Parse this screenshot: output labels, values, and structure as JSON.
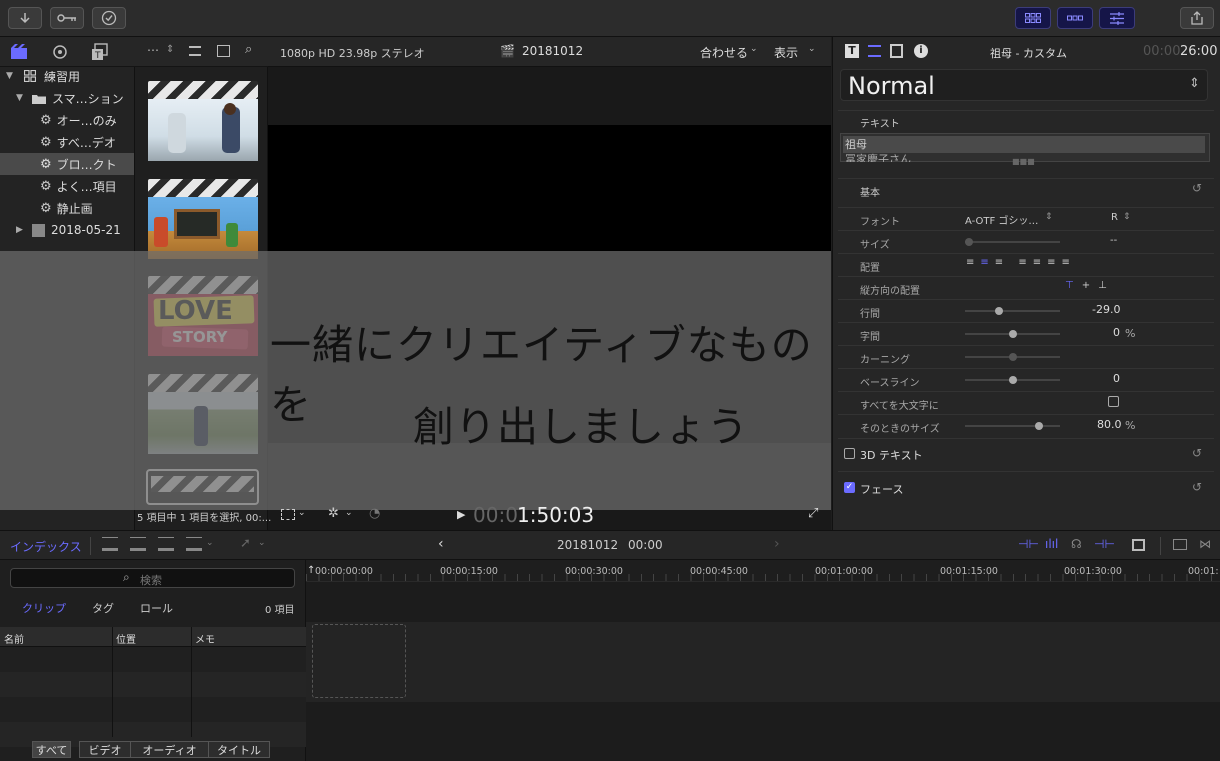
{
  "toolbar": {
    "import_icon": "down-arrow-icon",
    "keywords_icon": "key-icon",
    "check_icon": "checkmark-icon",
    "share_icon": "share-icon"
  },
  "library": {
    "items": [
      {
        "label": "練習用"
      },
      {
        "label": "スマ…ション"
      },
      {
        "label": "オー…のみ"
      },
      {
        "label": "すべ…デオ"
      },
      {
        "label": "ブロ…クト"
      },
      {
        "label": "よく…項目"
      },
      {
        "label": "静止画"
      },
      {
        "label": "2018-05-21"
      }
    ]
  },
  "browser": {
    "status": "5 項目中 1 項目を選択, 00:..."
  },
  "viewer": {
    "format": "1080p HD 23.98p ステレオ",
    "project": "20181012",
    "fit_label": "合わせる",
    "view_label": "表示",
    "timecode_dim": "00:0",
    "timecode": "1:50:03"
  },
  "inspector": {
    "title": "祖母 - カスタム",
    "duration_dim": "00:00",
    "duration": "26:00",
    "preset": "Normal",
    "text_header": "テキスト",
    "text_lines": [
      "祖母",
      "冨家慶子さん"
    ],
    "basic_header": "基本",
    "font_label": "フォント",
    "font_value": "A-OTF ゴシッ…",
    "font_style": "R",
    "size_label": "サイズ",
    "size_value": "--",
    "align_label": "配置",
    "valign_label": "縦方向の配置",
    "line_spacing_label": "行間",
    "line_spacing_value": "-29.0",
    "tracking_label": "字間",
    "tracking_value": "0",
    "percent": "%",
    "kerning_label": "カーニング",
    "baseline_label": "ベースライン",
    "baseline_value": "0",
    "allcaps_label": "すべてを大文字に",
    "allcaps_size_label": "そのときのサイズ",
    "allcaps_size_value": "80.0",
    "text3d_label": "3D テキスト",
    "face_label": "フェース"
  },
  "banner": {
    "line1": "一緒にクリエイティブなものを",
    "line2": "創り出しましょう"
  },
  "timeline_bar": {
    "index_label": "インデックス",
    "project": "20181012",
    "timecode": "00:00"
  },
  "index_panel": {
    "search_placeholder": "検索",
    "tabs": [
      "クリップ",
      "タグ",
      "ロール"
    ],
    "count": "0 項目",
    "columns": [
      "名前",
      "位置",
      "メモ"
    ],
    "filters": [
      "すべて",
      "ビデオ",
      "オーディオ",
      "タイトル"
    ]
  },
  "ruler": [
    "00:00:00:00",
    "00:00:15:00",
    "00:00:30:00",
    "00:00:45:00",
    "00:01:00:00",
    "00:01:15:00",
    "00:01:30:00",
    "00:01:"
  ],
  "colors": {
    "accent": "#6b6bff",
    "banner": "#6e6e6e"
  }
}
